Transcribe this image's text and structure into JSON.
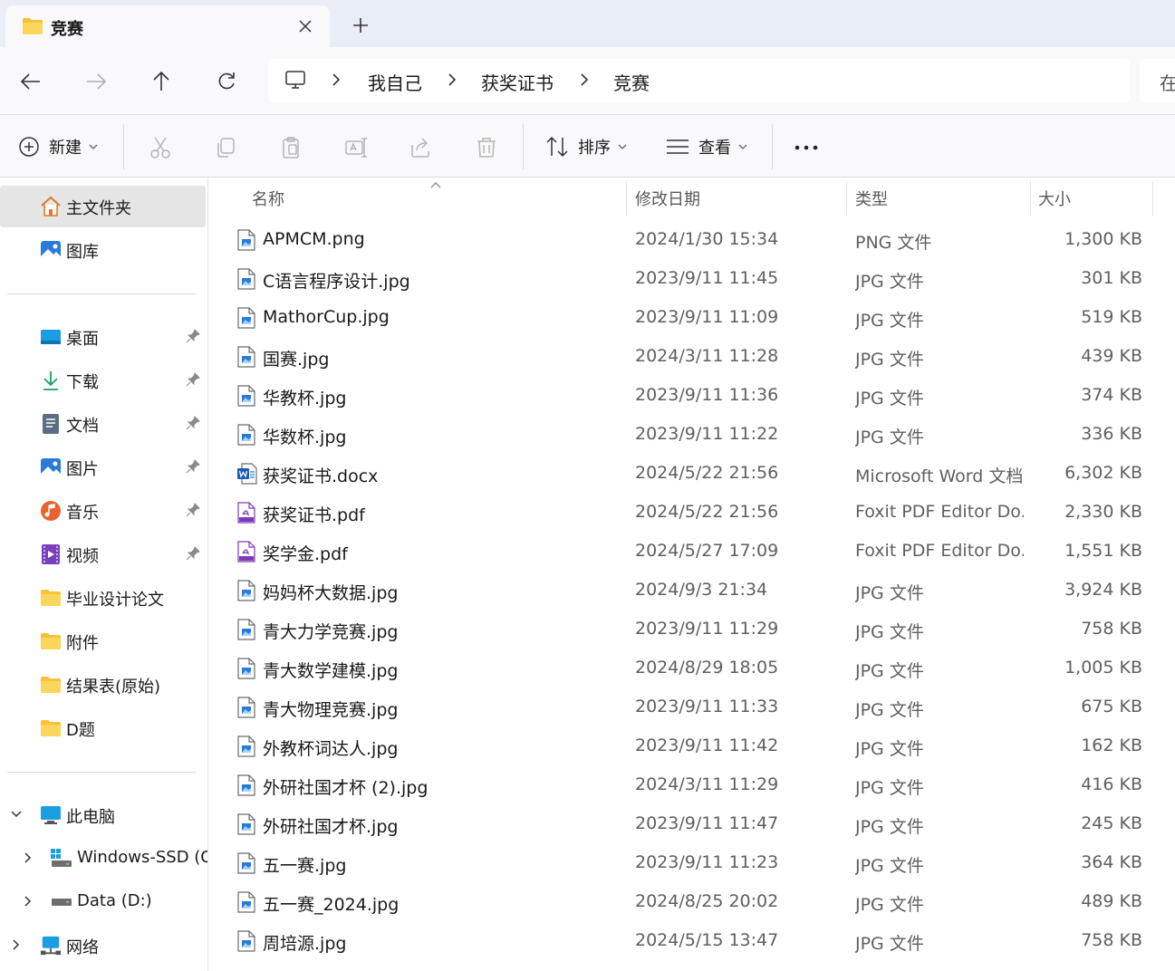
{
  "window": {
    "tab_title": "竞赛",
    "new_tab_symbol": "+"
  },
  "address": {
    "crumbs": [
      "我自己",
      "获奖证书",
      "竞赛"
    ],
    "search_partial": "在"
  },
  "commandbar": {
    "new_label": "新建",
    "sort_label": "排序",
    "view_label": "查看",
    "more_label": "···"
  },
  "sidebar": {
    "home": "主文件夹",
    "gallery": "图库",
    "quick": [
      {
        "label": "桌面",
        "icon": "desktop-icon",
        "pinned": true
      },
      {
        "label": "下载",
        "icon": "download-icon",
        "pinned": true
      },
      {
        "label": "文档",
        "icon": "documents-icon",
        "pinned": true
      },
      {
        "label": "图片",
        "icon": "pictures-icon",
        "pinned": true
      },
      {
        "label": "音乐",
        "icon": "music-icon",
        "pinned": true
      },
      {
        "label": "视频",
        "icon": "videos-icon",
        "pinned": true
      },
      {
        "label": "毕业设计论文",
        "icon": "folder-icon",
        "pinned": false
      },
      {
        "label": "附件",
        "icon": "folder-icon",
        "pinned": false
      },
      {
        "label": "结果表(原始)",
        "icon": "folder-icon",
        "pinned": false
      },
      {
        "label": "D题",
        "icon": "folder-icon",
        "pinned": false
      }
    ],
    "this_pc": "此电脑",
    "drives": [
      "Windows-SSD (C",
      "Data (D:)"
    ],
    "network": "网络"
  },
  "columns": {
    "name": "名称",
    "modified": "修改日期",
    "type": "类型",
    "size": "大小"
  },
  "files": [
    {
      "name": "APMCM.png",
      "date": "2024/1/30 15:34",
      "type": "PNG 文件",
      "size": "1,300 KB",
      "kind": "image"
    },
    {
      "name": "C语言程序设计.jpg",
      "date": "2023/9/11 11:45",
      "type": "JPG 文件",
      "size": "301 KB",
      "kind": "image"
    },
    {
      "name": "MathorCup.jpg",
      "date": "2023/9/11 11:09",
      "type": "JPG 文件",
      "size": "519 KB",
      "kind": "image"
    },
    {
      "name": "国赛.jpg",
      "date": "2024/3/11 11:28",
      "type": "JPG 文件",
      "size": "439 KB",
      "kind": "image"
    },
    {
      "name": "华教杯.jpg",
      "date": "2023/9/11 11:36",
      "type": "JPG 文件",
      "size": "374 KB",
      "kind": "image"
    },
    {
      "name": "华数杯.jpg",
      "date": "2023/9/11 11:22",
      "type": "JPG 文件",
      "size": "336 KB",
      "kind": "image"
    },
    {
      "name": "获奖证书.docx",
      "date": "2024/5/22 21:56",
      "type": "Microsoft Word 文档",
      "size": "6,302 KB",
      "kind": "word"
    },
    {
      "name": "获奖证书.pdf",
      "date": "2024/5/22 21:56",
      "type": "Foxit PDF Editor Do...",
      "size": "2,330 KB",
      "kind": "pdf"
    },
    {
      "name": "奖学金.pdf",
      "date": "2024/5/27 17:09",
      "type": "Foxit PDF Editor Do...",
      "size": "1,551 KB",
      "kind": "pdf"
    },
    {
      "name": "妈妈杯大数据.jpg",
      "date": "2024/9/3 21:34",
      "type": "JPG 文件",
      "size": "3,924 KB",
      "kind": "image"
    },
    {
      "name": "青大力学竞赛.jpg",
      "date": "2023/9/11 11:29",
      "type": "JPG 文件",
      "size": "758 KB",
      "kind": "image"
    },
    {
      "name": "青大数学建模.jpg",
      "date": "2024/8/29 18:05",
      "type": "JPG 文件",
      "size": "1,005 KB",
      "kind": "image"
    },
    {
      "name": "青大物理竞赛.jpg",
      "date": "2023/9/11 11:33",
      "type": "JPG 文件",
      "size": "675 KB",
      "kind": "image"
    },
    {
      "name": "外教杯词达人.jpg",
      "date": "2023/9/11 11:42",
      "type": "JPG 文件",
      "size": "162 KB",
      "kind": "image"
    },
    {
      "name": "外研社国才杯 (2).jpg",
      "date": "2024/3/11 11:29",
      "type": "JPG 文件",
      "size": "416 KB",
      "kind": "image"
    },
    {
      "name": "外研社国才杯.jpg",
      "date": "2023/9/11 11:47",
      "type": "JPG 文件",
      "size": "245 KB",
      "kind": "image"
    },
    {
      "name": "五一赛.jpg",
      "date": "2023/9/11 11:23",
      "type": "JPG 文件",
      "size": "364 KB",
      "kind": "image"
    },
    {
      "name": "五一赛_2024.jpg",
      "date": "2024/8/25 20:02",
      "type": "JPG 文件",
      "size": "489 KB",
      "kind": "image"
    },
    {
      "name": "周培源.jpg",
      "date": "2024/5/15 13:47",
      "type": "JPG 文件",
      "size": "758 KB",
      "kind": "image"
    }
  ],
  "colors": {
    "folder": "#f8c23a",
    "accent": "#0f6cbd",
    "selected_bg": "#e5e5e5"
  }
}
